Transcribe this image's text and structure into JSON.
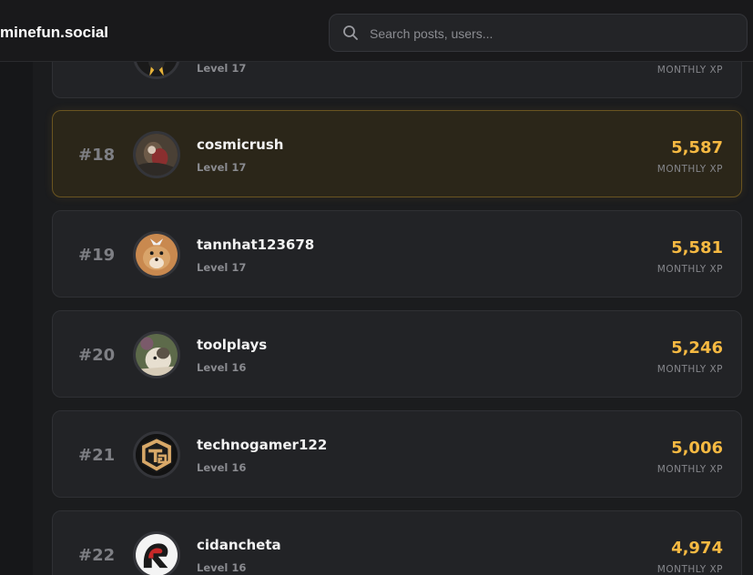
{
  "header": {
    "brand": "minefun.social",
    "search_placeholder": "Search posts, users..."
  },
  "xp_label": "MONTHLY XP",
  "rows": [
    {
      "rank": "",
      "username": "",
      "level": "Level 17",
      "xp": "",
      "xp_label": "MONTHLY XP"
    },
    {
      "rank": "#18",
      "username": "cosmicrush",
      "level": "Level 17",
      "xp": "5,587",
      "xp_label": "MONTHLY XP"
    },
    {
      "rank": "#19",
      "username": "tannhat123678",
      "level": "Level 17",
      "xp": "5,581",
      "xp_label": "MONTHLY XP"
    },
    {
      "rank": "#20",
      "username": "toolplays",
      "level": "Level 16",
      "xp": "5,246",
      "xp_label": "MONTHLY XP"
    },
    {
      "rank": "#21",
      "username": "technogamer122",
      "level": "Level 16",
      "xp": "5,006",
      "xp_label": "MONTHLY XP"
    },
    {
      "rank": "#22",
      "username": "cidancheta",
      "level": "Level 16",
      "xp": "4,974",
      "xp_label": "MONTHLY XP"
    }
  ],
  "colors": {
    "xp_accent": "#f5b942",
    "highlight_border": "#6a5420"
  }
}
